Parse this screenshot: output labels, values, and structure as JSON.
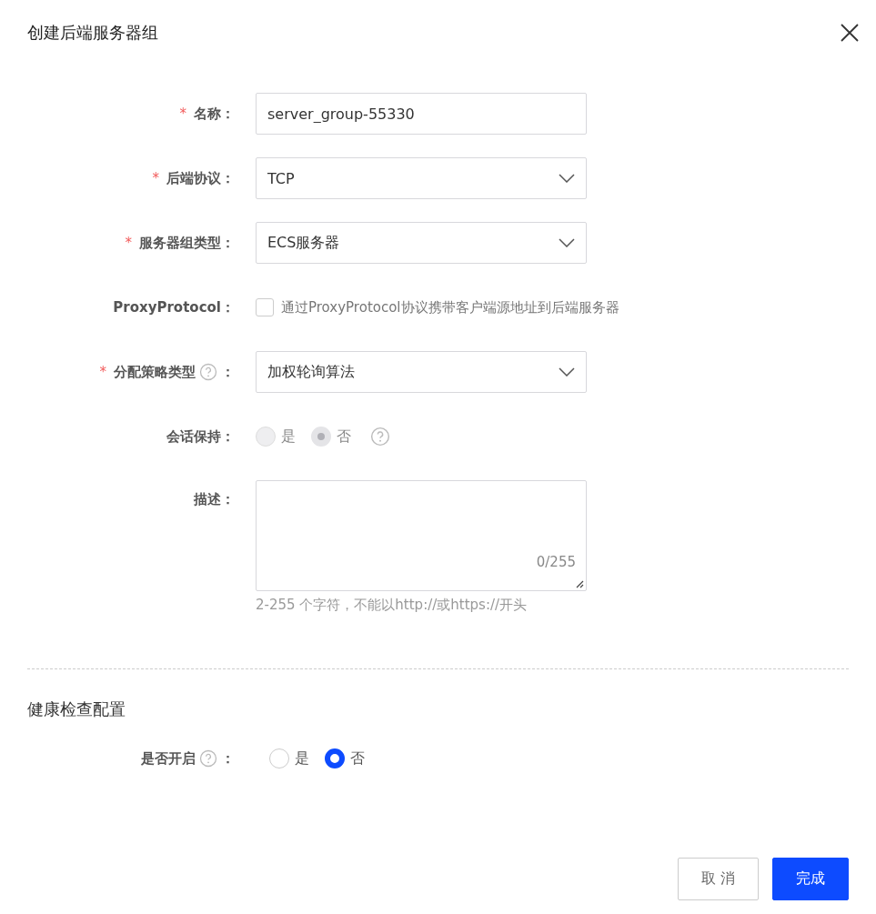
{
  "dialog": {
    "title": "创建后端服务器组"
  },
  "fields": [
    {
      "kind": "input",
      "asterisk": "*",
      "label": "名称",
      "colon": "：",
      "value": "server_group-55330"
    },
    {
      "kind": "select",
      "asterisk": "*",
      "label": "后端协议",
      "colon": "：",
      "value": "TCP"
    },
    {
      "kind": "select",
      "asterisk": "*",
      "label": "服务器组类型",
      "colon": "：",
      "value": "ECS服务器"
    },
    {
      "kind": "checkbox",
      "label": "ProxyProtocol",
      "colon": "：",
      "checked": false,
      "text": "通过ProxyProtocol协议携带客户端源地址到后端服务器"
    },
    {
      "kind": "select",
      "asterisk": "*",
      "label": "分配策略类型",
      "help": true,
      "colon": "：",
      "value": "加权轮询算法"
    },
    {
      "kind": "radio",
      "label": "会话保持",
      "colon": "：",
      "disabled": true,
      "trailing_help": true,
      "options": [
        {
          "label": "是",
          "selected": false
        },
        {
          "label": "否",
          "selected": true
        }
      ]
    },
    {
      "kind": "textarea",
      "label": "描述",
      "colon": "：",
      "counter": "0/255",
      "hint": "2-255 个字符，不能以http://或https://开头"
    }
  ],
  "health_section": {
    "title": "健康检查配置",
    "label": "是否开启",
    "help": true,
    "colon": "：",
    "disabled": false,
    "options": [
      {
        "label": "是",
        "selected": false
      },
      {
        "label": "否",
        "selected": true
      }
    ]
  },
  "buttons": [
    {
      "label": "取 消",
      "kind": "secondary"
    },
    {
      "label": "完成",
      "kind": "primary"
    }
  ]
}
